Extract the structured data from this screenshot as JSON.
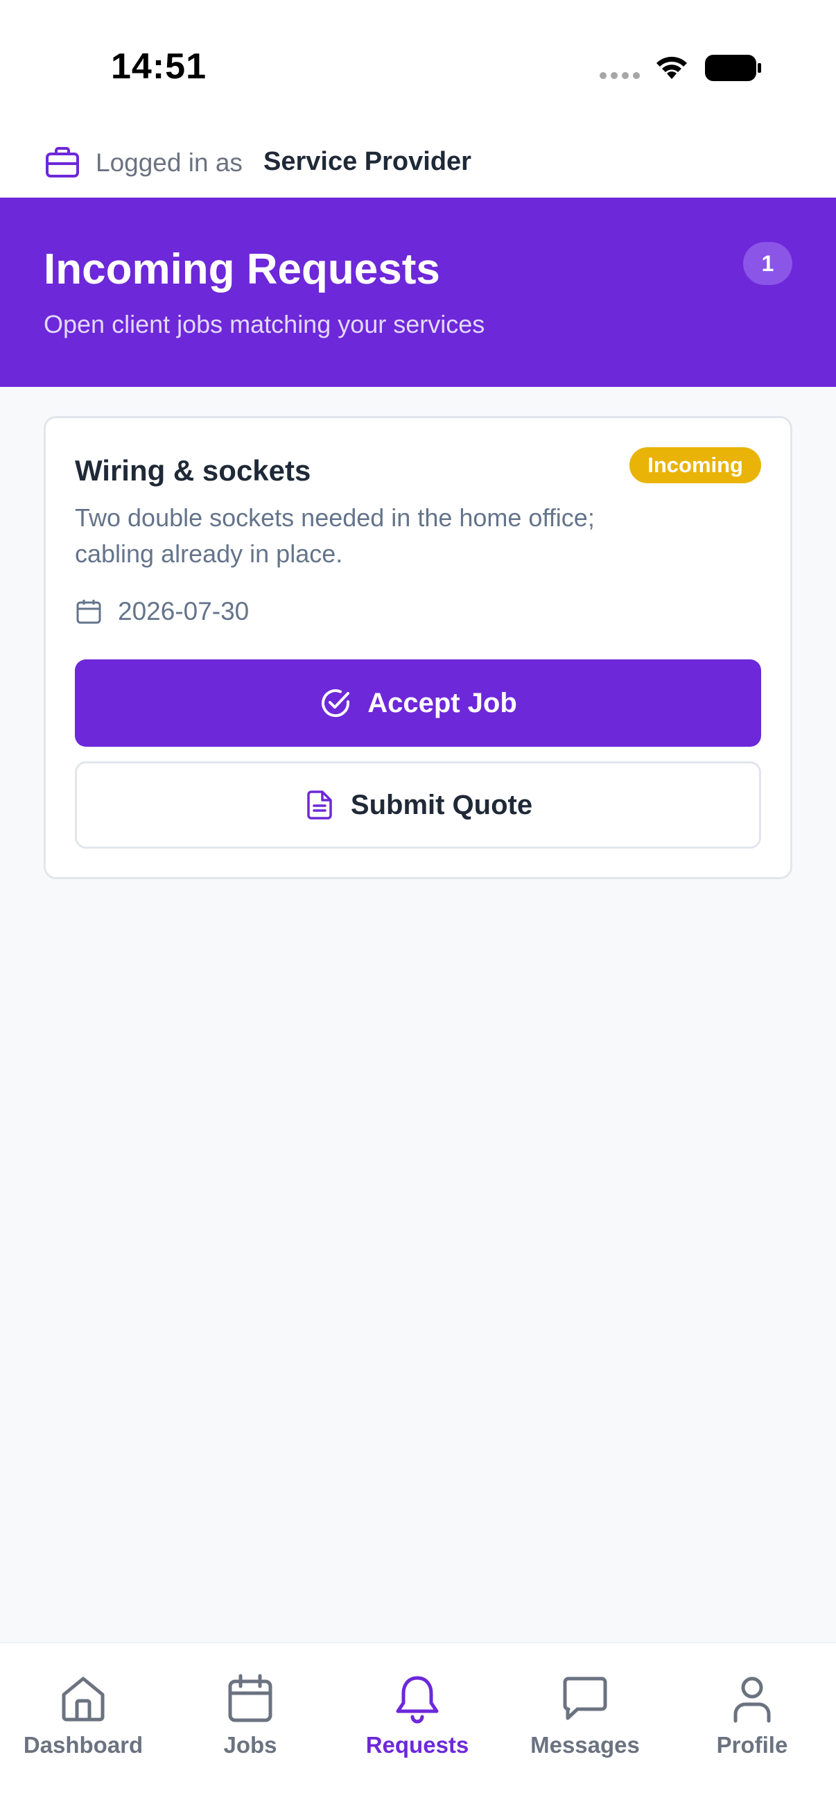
{
  "status_bar": {
    "time": "14:51"
  },
  "session": {
    "logged_in_label": "Logged in as",
    "role": "Service Provider"
  },
  "header": {
    "title": "Incoming Requests",
    "subtitle": "Open client jobs matching your services",
    "count": "1"
  },
  "requests": [
    {
      "title": "Wiring & sockets",
      "status": "Incoming",
      "description": "Two double sockets needed in the home office; cabling already in place.",
      "date": "2026-07-30",
      "accept_label": "Accept Job",
      "quote_label": "Submit Quote"
    }
  ],
  "nav": {
    "items": [
      {
        "label": "Dashboard",
        "icon": "home-icon",
        "active": false
      },
      {
        "label": "Jobs",
        "icon": "calendar-icon",
        "active": false
      },
      {
        "label": "Requests",
        "icon": "bell-icon",
        "active": true
      },
      {
        "label": "Messages",
        "icon": "message-icon",
        "active": false
      },
      {
        "label": "Profile",
        "icon": "user-icon",
        "active": false
      }
    ]
  },
  "colors": {
    "primary": "#6d28d9",
    "badge_incoming": "#eab308",
    "text_dark": "#1f2937",
    "text_muted": "#64748b",
    "background": "#f8f9fb"
  }
}
